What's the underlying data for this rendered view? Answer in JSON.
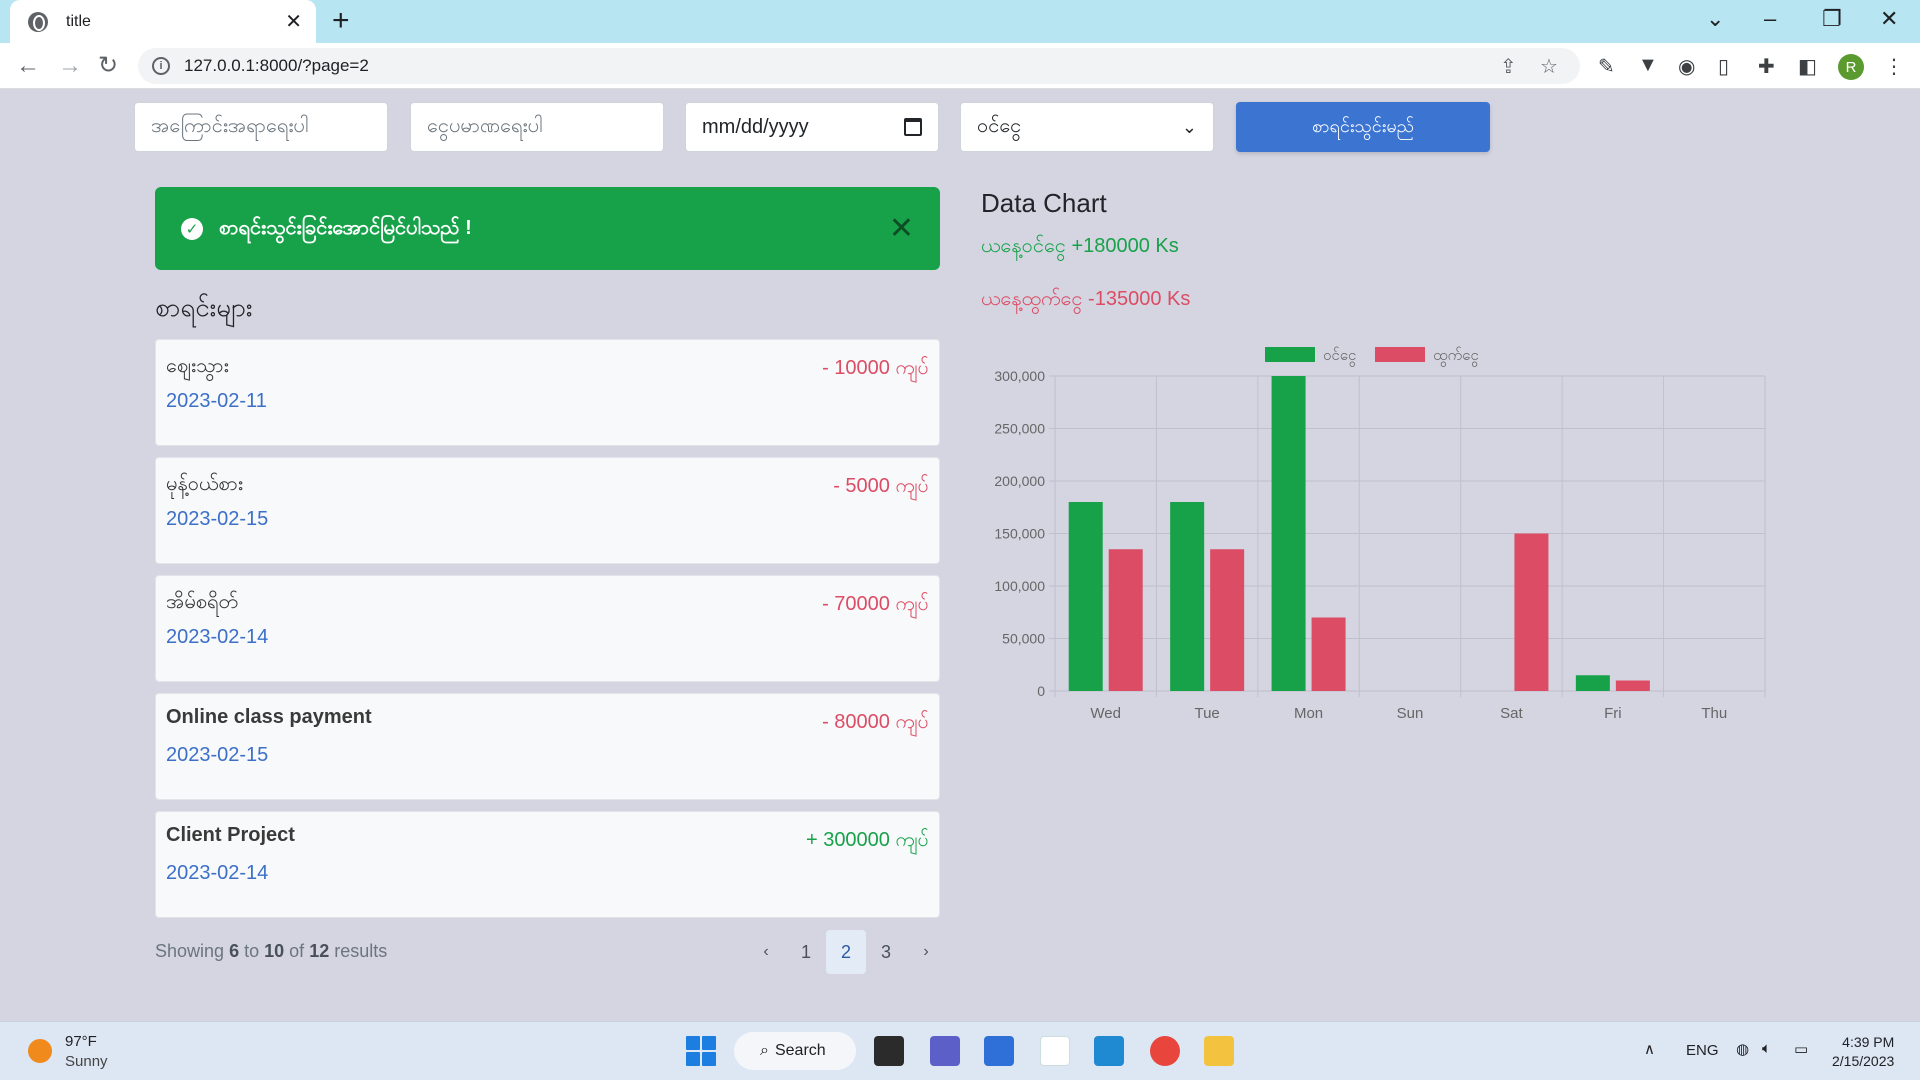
{
  "browser": {
    "tab_title": "title",
    "tab_close": "✕",
    "new_tab": "+",
    "url": "127.0.0.1:8000/?page=2"
  },
  "filters": {
    "reason_placeholder": "အကြောင်းအရာရေးပါ",
    "amount_placeholder": "ငွေပမာဏရေးပါ",
    "date_placeholder": "mm/dd/yyyy",
    "type_selected": "ဝင်ငွေ",
    "submit_label": "စာရင်းသွင်းမည်"
  },
  "alert": {
    "message": "စာရင်းသွင်းခြင်းအောင်မြင်ပါသည် !",
    "close": "✕",
    "color": "#17a24a"
  },
  "list": {
    "title": "စာရင်းများ",
    "items": [
      {
        "name": "ဈေးသွား",
        "date": "2023-02-11",
        "amount": "- 10000 ကျပ်",
        "direction": "out"
      },
      {
        "name": "မုန့်ဝယ်စား",
        "date": "2023-02-15",
        "amount": "- 5000 ကျပ်",
        "direction": "out"
      },
      {
        "name": "အိမ်စရိတ်",
        "date": "2023-02-14",
        "amount": "- 70000 ကျပ်",
        "direction": "out"
      },
      {
        "name": "Online class payment",
        "date": "2023-02-15",
        "amount": "- 80000 ကျပ်",
        "direction": "out"
      },
      {
        "name": "Client Project",
        "date": "2023-02-14",
        "amount": "+ 300000 ကျပ်",
        "direction": "in"
      }
    ]
  },
  "pagination": {
    "showing_prefix": "Showing",
    "from": "6",
    "to_word": "to",
    "to": "10",
    "of_word": "of",
    "total": "12",
    "results_word": "results",
    "prev": "‹",
    "pages": [
      "1",
      "2",
      "3"
    ],
    "current": "2",
    "next": "›"
  },
  "stats": {
    "chart_title": "Data Chart",
    "today_in": "ယနေ့ဝင်ငွေ +180000 Ks",
    "today_out": "ယနေ့ထွက်ငွေ -135000 Ks"
  },
  "chart_data": {
    "type": "bar",
    "categories": [
      "Wed",
      "Tue",
      "Mon",
      "Sun",
      "Sat",
      "Fri",
      "Thu"
    ],
    "series": [
      {
        "name": "ဝင်ငွေ",
        "color": "#17a24a",
        "values": [
          180000,
          180000,
          300000,
          0,
          0,
          15000,
          0
        ]
      },
      {
        "name": "ထွက်ငွေ",
        "color": "#dc4c64",
        "values": [
          135000,
          135000,
          70000,
          0,
          150000,
          10000,
          0
        ]
      }
    ],
    "ylim": [
      0,
      300000
    ],
    "yticks": [
      "0",
      "50,000",
      "100,000",
      "150,000",
      "200,000",
      "250,000",
      "300,000"
    ],
    "legend": "top-center",
    "grid": true
  },
  "taskbar": {
    "temp": "97°F",
    "weather": "Sunny",
    "search_label": "Search",
    "lang": "ENG",
    "time": "4:39 PM",
    "date": "2/15/2023"
  },
  "profile_initial": "R"
}
